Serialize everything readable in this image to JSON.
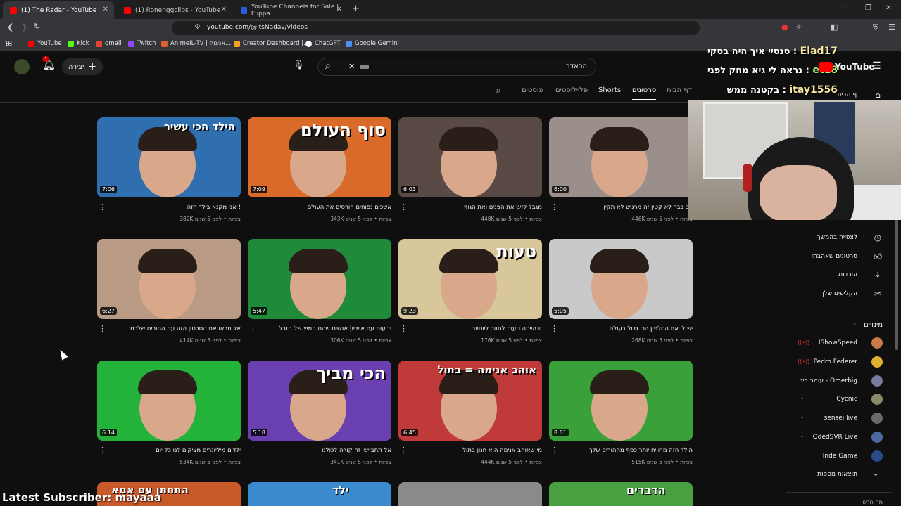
{
  "browser": {
    "tabs": [
      {
        "title": "(1) The Radar - YouTube",
        "active": true
      },
      {
        "title": "(1) Ronenggclips - YouTube",
        "active": false
      },
      {
        "title": "YouTube Channels for Sale | Flippa",
        "active": false
      }
    ],
    "url": "youtube.com/@itsNadav/videos",
    "bookmarks": [
      "YouTube",
      "Kick",
      "gmail",
      "Twitch",
      "AnimeIL-TV | אנימה...",
      "Creator Dashboard |...",
      "ChatGPT",
      "Google Gemini"
    ]
  },
  "header": {
    "search_query": "הראדר",
    "create_label": "יצירה",
    "notification_count": "1",
    "logo_text": "YouTube"
  },
  "channel_tabs": [
    "דף הבית",
    "סרטונים",
    "Shorts",
    "פלייליסטים",
    "פוסטים"
  ],
  "videos": [
    {
      "title": "אני מקנא בילד הזה !",
      "meta": "382K צפיות • לפני 5 שנים",
      "duration": "7:06",
      "overlay": "הילד הכי עשיר",
      "bg": "#2f6fb0"
    },
    {
      "title": "אשכים נפוחים הורסים את העולם",
      "meta": "343K צפיות • לפני 5 שנים",
      "duration": "7:09",
      "overlay": "סוף העולם",
      "bg": "#d96a2a"
    },
    {
      "title": "מגבל לזיגי את הפנים ואת הגוף",
      "meta": "448K צפיות • לפני 5 שנים",
      "duration": "6:03",
      "overlay": "",
      "bg": "#5a4a45"
    },
    {
      "title": "בב בבר לא קטין זה מרגיש לא תקין",
      "meta": "446K צפיות • לפני 5 שנים",
      "duration": "6:00",
      "overlay": "",
      "bg": "#9a8f8a"
    },
    {
      "title": "אל תראו את הסרטון הזה עם ההורים שלכם",
      "meta": "414K צפיות • לפני 5 שנים",
      "duration": "6:27",
      "overlay": "",
      "bg": "#b89a85"
    },
    {
      "title": "ידיעות עם איידיו| אנשים שהם המיץ של הזבל",
      "meta": "306K צפיות • לפני 5 שנים",
      "duration": "5:47",
      "overlay": "",
      "bg": "#1f8a3a"
    },
    {
      "title": "זו הייתה טעות לחזור ליוטיוב",
      "meta": "176K צפיות • לפני 5 שנים",
      "duration": "9:23",
      "overlay": "טעות",
      "bg": "#d8c79a"
    },
    {
      "title": "יש לי את הטלפון הכי גדול בעולם",
      "meta": "268K צפיות • לפני 5 שנים",
      "duration": "5:05",
      "overlay": "",
      "bg": "#c9c9c9"
    },
    {
      "title": "ילדים מיליונרים מציקים לנו כל יום",
      "meta": "534K צפיות • לפני 5 שנים",
      "duration": "6:14",
      "overlay": "",
      "bg": "#23b23a"
    },
    {
      "title": "אל תתביישו זה קורה לכולנו",
      "meta": "341K צפיות • לפני 5 שנים",
      "duration": "5:18",
      "overlay": "הכי מביך",
      "bg": "#6a3fb0"
    },
    {
      "title": "מי שאוהב אנימה הוא חנון בתול",
      "meta": "444K צפיות • לפני 5 שנים",
      "duration": "6:45",
      "overlay": "אוהב אנימה = בתול",
      "bg": "#c03a3a"
    },
    {
      "title": "הילד הזה מרוויח יותר כסף מההורים שלך",
      "meta": "515K צפיות • לפני 5 שנים",
      "duration": "8:01",
      "overlay": "",
      "bg": "#3aa03a"
    }
  ],
  "bottom_thumbs": [
    "התחתן עם אמא",
    "ילד",
    "",
    "הדברים"
  ],
  "sidebar": {
    "top_label": "דף הבית",
    "you_items": [
      {
        "label": "לצפייה בהמשך",
        "icon": "clock-icon"
      },
      {
        "label": "סרטונים שאהבתי",
        "icon": "thumbs-up-icon"
      },
      {
        "label": "הורדות",
        "icon": "download-icon"
      },
      {
        "label": "הקליפים שלך",
        "icon": "scissors-icon"
      }
    ],
    "subs_header": "מינויים",
    "subscriptions": [
      {
        "name": "IShowSpeed",
        "live": true,
        "color": "#c87a4a"
      },
      {
        "name": "Pedro Federer",
        "live": true,
        "color": "#e0b030"
      },
      {
        "name": "עומר ביג - Omerbig",
        "live": false,
        "color": "#7a7aa0"
      },
      {
        "name": "Cycnic",
        "live": false,
        "dot": true,
        "color": "#8a8a6a"
      },
      {
        "name": "sensei live",
        "live": false,
        "dot": true,
        "color": "#6a6a6a"
      },
      {
        "name": "OdedSVR Live",
        "live": false,
        "dot": true,
        "color": "#4a6aa0"
      },
      {
        "name": "Inde Game",
        "live": false,
        "dot": false,
        "color": "#2a4a8a"
      }
    ],
    "show_more": "תוצאות נוספות",
    "bottom_label": "מה חדש"
  },
  "stream": {
    "chat": [
      {
        "user": "Elad17",
        "msg": "סנסיי איך היה בסקי"
      },
      {
        "user": "et18",
        "msg": "נראה לי גיא מחק לפני"
      },
      {
        "user": "itay1556",
        "msg": "בקטנה ממש"
      }
    ],
    "alert": "Latest Subscriber: mayaaa"
  }
}
